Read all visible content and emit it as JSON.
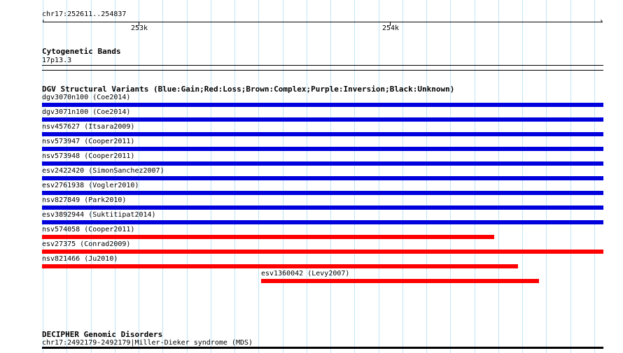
{
  "ruler": {
    "range_label": "chr17:252611..254837",
    "tick_labels": [
      "253k",
      "254k"
    ]
  },
  "cytogenetic": {
    "title": "Cytogenetic Bands",
    "band": "17p13.3"
  },
  "dgv": {
    "title": "DGV Structural Variants (Blue:Gain;Red:Loss;Brown:Complex;Purple:Inversion;Black:Unknown)",
    "variants": [
      {
        "label": "dgv3070n100 (Coe2014)",
        "type": "gain"
      },
      {
        "label": "dgv3071n100 (Coe2014)",
        "type": "gain"
      },
      {
        "label": "nsv457627 (Itsara2009)",
        "type": "gain"
      },
      {
        "label": "nsv573947 (Cooper2011)",
        "type": "gain"
      },
      {
        "label": "nsv573948 (Cooper2011)",
        "type": "gain"
      },
      {
        "label": "esv2422420 (SimonSanchez2007)",
        "type": "gain"
      },
      {
        "label": "esv2761938 (Vogler2010)",
        "type": "gain"
      },
      {
        "label": "nsv827849 (Park2010)",
        "type": "gain"
      },
      {
        "label": "esv3892944 (Suktitipat2014)",
        "type": "gain"
      },
      {
        "label": "nsv574058 (Cooper2011)",
        "type": "loss"
      },
      {
        "label": "esv27375 (Conrad2009)",
        "type": "loss"
      },
      {
        "label": "nsv821466 (Ju2010)",
        "type": "loss"
      },
      {
        "label": "esv1360042 (Levy2007)",
        "type": "loss"
      }
    ]
  },
  "decipher": {
    "title": "DECIPHER Genomic Disorders",
    "entry": "chr17:2492179-2492179|Miller-Dieker syndrome (MDS)"
  },
  "colors": {
    "gain": "#0000dd",
    "loss": "#ff0000",
    "grid": "#bfe4f5"
  }
}
